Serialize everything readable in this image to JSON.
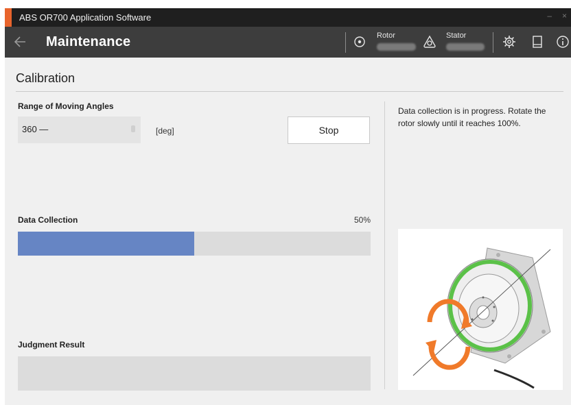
{
  "window": {
    "title": "ABS OR700 Application Software",
    "minimize_glyph": "–",
    "close_glyph": "×"
  },
  "appbar": {
    "page_title": "Maintenance",
    "rotor_label": "Rotor",
    "stator_label": "Stator"
  },
  "calibration": {
    "heading": "Calibration",
    "range_label": "Range of Moving Angles",
    "range_value": "360 —",
    "range_unit": "[deg]",
    "stop_label": "Stop",
    "info_text": "Data collection is in progress. Rotate the rotor slowly until it reaches 100%.",
    "data_collection_label": "Data Collection",
    "progress_text": "50%",
    "progress_fraction": 0.5,
    "judgment_label": "Judgment Result"
  },
  "colors": {
    "accent": "#e8642c",
    "progress_fill": "#6685c4",
    "titlebar": "#1f1f1f",
    "appbar": "#3d3d3d",
    "ring_green": "#5bc148",
    "rotation_arrow": "#f07a2a"
  },
  "icons": {
    "back": "arrow-left-icon",
    "rotor": "rotor-target-icon",
    "stator": "stator-icon",
    "settings": "gear-icon",
    "manual": "document-icon",
    "info": "info-icon"
  }
}
